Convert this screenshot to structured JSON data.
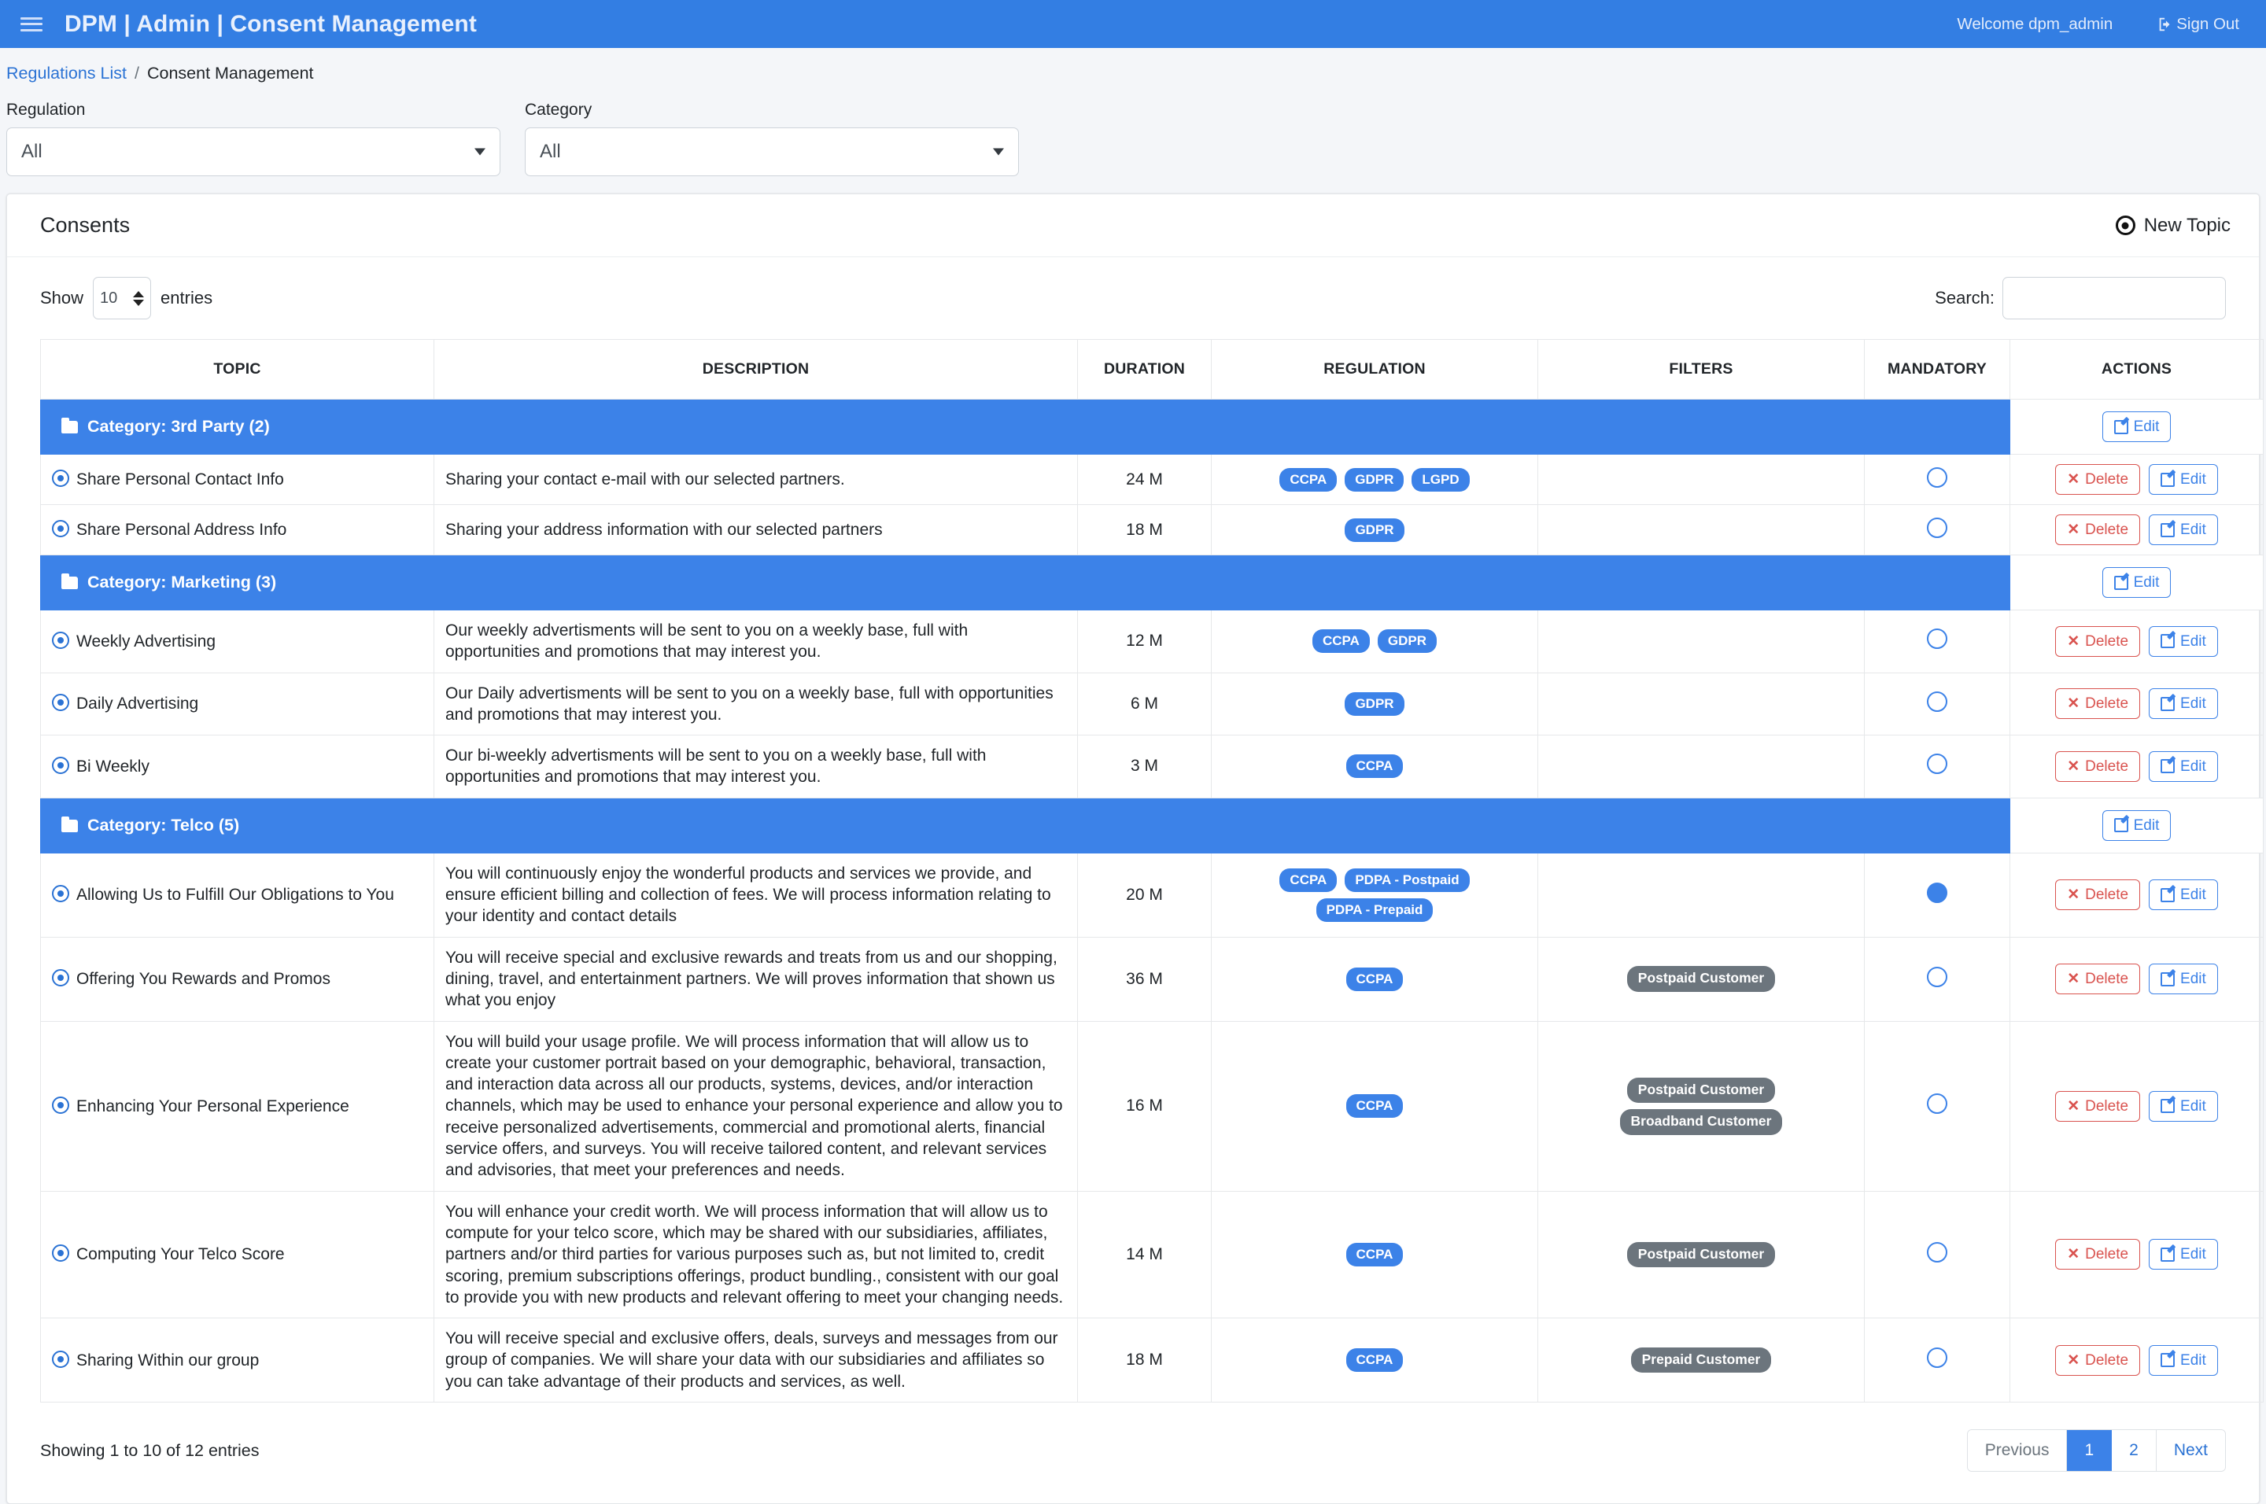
{
  "navbar": {
    "menu_icon": "hamburger-icon",
    "brand": "DPM | Admin | Consent Management",
    "welcome": "Welcome dpm_admin",
    "signout": "Sign Out"
  },
  "breadcrumb": {
    "parent": "Regulations List",
    "separator": "/",
    "current": "Consent Management"
  },
  "filters": {
    "regulation": {
      "label": "Regulation",
      "value": "All"
    },
    "category": {
      "label": "Category",
      "value": "All"
    }
  },
  "card": {
    "title": "Consents",
    "new_topic": "New Topic"
  },
  "controls": {
    "show_prefix": "Show",
    "entries_value": "10",
    "show_suffix": "entries",
    "search_label": "Search:",
    "search_value": "",
    "search_placeholder": ""
  },
  "table": {
    "headers": {
      "topic": "TOPIC",
      "description": "DESCRIPTION",
      "duration": "DURATION",
      "regulation": "REGULATION",
      "filters": "FILTERS",
      "mandatory": "MANDATORY",
      "actions": "ACTIONS"
    },
    "buttons": {
      "delete": "Delete",
      "edit": "Edit"
    },
    "groups": [
      {
        "category_label": "Category: 3rd Party (2)",
        "rows": [
          {
            "topic": "Share Personal Contact Info",
            "description": "Sharing your contact e-mail with our selected partners.",
            "duration": "24 M",
            "regulations": [
              "CCPA",
              "GDPR",
              "LGPD"
            ],
            "filters": [],
            "mandatory": false
          },
          {
            "topic": "Share Personal Address Info",
            "description": "Sharing your address information with our selected partners",
            "duration": "18 M",
            "regulations": [
              "GDPR"
            ],
            "filters": [],
            "mandatory": false
          }
        ]
      },
      {
        "category_label": "Category: Marketing (3)",
        "rows": [
          {
            "topic": "Weekly Advertising",
            "description": "Our weekly advertisments will be sent to you on a weekly base, full with opportunities and promotions that may interest you.",
            "duration": "12 M",
            "regulations": [
              "CCPA",
              "GDPR"
            ],
            "filters": [],
            "mandatory": false
          },
          {
            "topic": "Daily Advertising",
            "description": "Our Daily advertisments will be sent to you on a weekly base, full with opportunities and promotions that may interest you.",
            "duration": "6 M",
            "regulations": [
              "GDPR"
            ],
            "filters": [],
            "mandatory": false
          },
          {
            "topic": "Bi Weekly",
            "description": "Our bi-weekly advertisments will be sent to you on a weekly base, full with opportunities and promotions that may interest you.",
            "duration": "3 M",
            "regulations": [
              "CCPA"
            ],
            "filters": [],
            "mandatory": false
          }
        ]
      },
      {
        "category_label": "Category: Telco (5)",
        "rows": [
          {
            "topic": "Allowing Us to Fulfill Our Obligations to You",
            "description": "You will continuously enjoy the wonderful products and services we provide, and ensure efficient billing and collection of fees. We will process information relating to your identity and contact details",
            "duration": "20 M",
            "regulations": [
              "CCPA",
              "PDPA - Postpaid",
              "PDPA - Prepaid"
            ],
            "filters": [],
            "mandatory": true
          },
          {
            "topic": "Offering You Rewards and Promos",
            "description": "You will receive special and exclusive rewards and treats from us and our shopping, dining, travel, and entertainment partners. We will proves information that shown us what you enjoy",
            "duration": "36 M",
            "regulations": [
              "CCPA"
            ],
            "filters": [
              "Postpaid Customer"
            ],
            "mandatory": false
          },
          {
            "topic": "Enhancing Your Personal Experience",
            "description": "You will build your usage profile. We will process information that will allow us to create your customer portrait based on your demographic, behavioral, transaction, and interaction data across all our products, systems, devices, and/or interaction channels, which may be used to enhance your personal experience and allow you to receive personalized advertisements, commercial and promotional alerts, financial service offers, and surveys. You will receive tailored content, and relevant services and advisories, that meet your preferences and needs.",
            "duration": "16 M",
            "regulations": [
              "CCPA"
            ],
            "filters": [
              "Postpaid Customer",
              "Broadband Customer"
            ],
            "mandatory": false
          },
          {
            "topic": "Computing Your Telco Score",
            "description": "You will enhance your credit worth. We will process information that will allow us to compute for your telco score, which may be shared with our subsidiaries, affiliates, partners and/or third parties for various purposes such as, but not limited to, credit scoring, premium subscriptions offerings, product bundling., consistent with our goal to provide you with new products and relevant offering to meet your changing needs.",
            "duration": "14 M",
            "regulations": [
              "CCPA"
            ],
            "filters": [
              "Postpaid Customer"
            ],
            "mandatory": false
          },
          {
            "topic": "Sharing Within our group",
            "description": "You will receive special and exclusive offers, deals, surveys and messages from our group of companies. We will share your data with our subsidiaries and affiliates so you can take advantage of their products and services, as well.",
            "duration": "18 M",
            "regulations": [
              "CCPA"
            ],
            "filters": [
              "Prepaid Customer"
            ],
            "mandatory": false
          }
        ]
      }
    ]
  },
  "footer": {
    "showing": "Showing 1 to 10 of 12 entries",
    "pagination": {
      "previous": "Previous",
      "pages": [
        "1",
        "2"
      ],
      "active_page": "1",
      "next": "Next"
    }
  },
  "colors": {
    "brand_blue": "#337ee3",
    "accent_blue": "#3c82e8",
    "link_blue": "#2a72d4",
    "danger_red": "#d9534f",
    "filter_gray": "#6c757d",
    "page_bg": "#f4f6f9"
  }
}
